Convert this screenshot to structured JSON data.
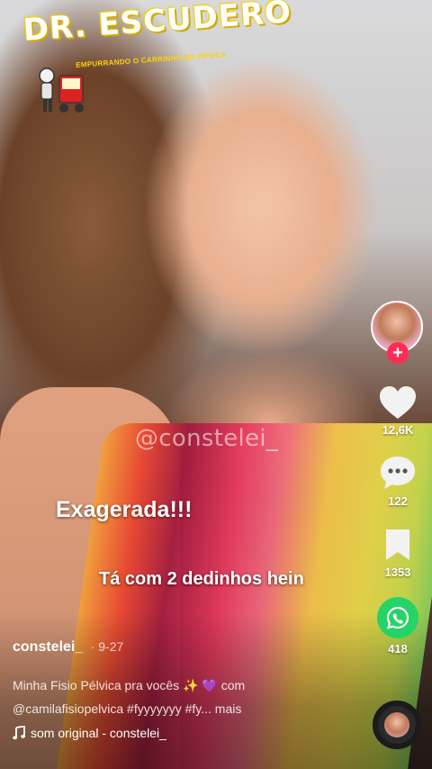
{
  "brand": {
    "title": "DR. ESCUDERO",
    "subtitle": "EMPURRANDO O CARRINHO DE PIPOCA"
  },
  "video": {
    "watermark": "@constelei_",
    "caption_primary": "Exagerada!!!",
    "caption_secondary": "Tá com 2 dedinhos hein"
  },
  "sidebar": {
    "follow_label": "+",
    "likes": "12,6K",
    "comments": "122",
    "saves": "1353",
    "shares": "418"
  },
  "post": {
    "username": "constelei_",
    "date": "· 9-27",
    "description_text": "Minha Fisio Pélvica pra vocês",
    "sparkle": "✨",
    "heart": "💜",
    "with": "com",
    "mention_line": "@camilafisiopelvica #fyyyyyyy #fy... mais",
    "sound_label": "som original - constelei_"
  },
  "colors": {
    "accent": "#fe2c55",
    "whatsapp": "#25d366",
    "logo_yellow": "#ffd400"
  },
  "icons": {
    "like": "heart-icon",
    "comment": "comment-bubble-icon",
    "save": "bookmark-icon",
    "share": "whatsapp-icon",
    "sound": "music-note-icon"
  }
}
